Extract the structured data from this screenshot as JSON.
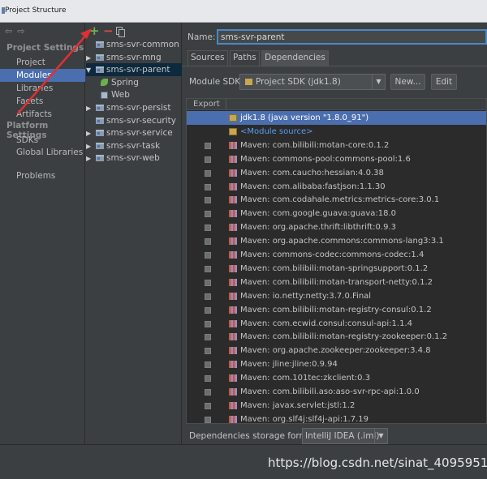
{
  "window": {
    "title": "Project Structure"
  },
  "left_nav": {
    "back_icon": "back-arrow-icon",
    "forward_icon": "forward-arrow-icon",
    "project_settings_header": "Project Settings",
    "project_settings_items": [
      "Project",
      "Modules",
      "Libraries",
      "Facets",
      "Artifacts"
    ],
    "platform_settings_header": "Platform Settings",
    "platform_settings_items": [
      "SDKs",
      "Global Libraries"
    ],
    "problems": "Problems",
    "selected": "Modules"
  },
  "toolbar": {
    "add": "+",
    "remove": "−"
  },
  "module_tree": [
    {
      "label": "sms-svr-common",
      "expandable": false,
      "level": 0
    },
    {
      "label": "sms-svr-mng",
      "expandable": true,
      "level": 0
    },
    {
      "label": "sms-svr-parent",
      "expandable": true,
      "expanded": true,
      "level": 0,
      "selected": true
    },
    {
      "label": "Spring",
      "level": 1,
      "icon": "spring-leaf-icon"
    },
    {
      "label": "Web",
      "level": 1,
      "icon": "web-icon"
    },
    {
      "label": "sms-svr-persist",
      "expandable": true,
      "level": 0
    },
    {
      "label": "sms-svr-security",
      "expandable": false,
      "level": 0
    },
    {
      "label": "sms-svr-service",
      "expandable": true,
      "level": 0
    },
    {
      "label": "sms-svr-task",
      "expandable": true,
      "level": 0
    },
    {
      "label": "sms-svr-web",
      "expandable": true,
      "level": 0
    }
  ],
  "detail": {
    "name_label": "Name:",
    "name_value": "sms-svr-parent",
    "tabs": [
      "Sources",
      "Paths",
      "Dependencies"
    ],
    "active_tab": "Dependencies",
    "module_sdk_label": "Module SDK:",
    "module_sdk_value": "Project SDK (jdk1.8)",
    "new_button": "New...",
    "edit_button": "Edit",
    "export_header": "Export",
    "dependencies": [
      {
        "text": "jdk1.8 (java version \"1.8.0_91\")",
        "kind": "jdk",
        "selected": true,
        "checkbox": false
      },
      {
        "text": "<Module source>",
        "kind": "source",
        "checkbox": false
      },
      {
        "text": "Maven: com.bilibili:motan-core:0.1.2",
        "kind": "maven",
        "checkbox": true
      },
      {
        "text": "Maven: commons-pool:commons-pool:1.6",
        "kind": "maven",
        "checkbox": true
      },
      {
        "text": "Maven: com.caucho:hessian:4.0.38",
        "kind": "maven",
        "checkbox": true
      },
      {
        "text": "Maven: com.alibaba:fastjson:1.1.30",
        "kind": "maven",
        "checkbox": true
      },
      {
        "text": "Maven: com.codahale.metrics:metrics-core:3.0.1",
        "kind": "maven",
        "checkbox": true
      },
      {
        "text": "Maven: com.google.guava:guava:18.0",
        "kind": "maven",
        "checkbox": true
      },
      {
        "text": "Maven: org.apache.thrift:libthrift:0.9.3",
        "kind": "maven",
        "checkbox": true
      },
      {
        "text": "Maven: org.apache.commons:commons-lang3:3.1",
        "kind": "maven",
        "checkbox": true
      },
      {
        "text": "Maven: commons-codec:commons-codec:1.4",
        "kind": "maven",
        "checkbox": true
      },
      {
        "text": "Maven: com.bilibili:motan-springsupport:0.1.2",
        "kind": "maven",
        "checkbox": true
      },
      {
        "text": "Maven: com.bilibili:motan-transport-netty:0.1.2",
        "kind": "maven",
        "checkbox": true
      },
      {
        "text": "Maven: io.netty:netty:3.7.0.Final",
        "kind": "maven",
        "checkbox": true
      },
      {
        "text": "Maven: com.bilibili:motan-registry-consul:0.1.2",
        "kind": "maven",
        "checkbox": true
      },
      {
        "text": "Maven: com.ecwid.consul:consul-api:1.1.4",
        "kind": "maven",
        "checkbox": true
      },
      {
        "text": "Maven: com.bilibili:motan-registry-zookeeper:0.1.2",
        "kind": "maven",
        "checkbox": true
      },
      {
        "text": "Maven: org.apache.zookeeper:zookeeper:3.4.8",
        "kind": "maven",
        "checkbox": true
      },
      {
        "text": "Maven: jline:jline:0.9.94",
        "kind": "maven",
        "checkbox": true
      },
      {
        "text": "Maven: com.101tec:zkclient:0.3",
        "kind": "maven",
        "checkbox": true
      },
      {
        "text": "Maven: com.bilibili.aso:aso-svr-rpc-api:1.0.0",
        "kind": "maven",
        "checkbox": true
      },
      {
        "text": "Maven: javax.servlet:jstl:1.2",
        "kind": "maven",
        "checkbox": true
      },
      {
        "text": "Maven: org.slf4j:slf4j-api:1.7.19",
        "kind": "maven",
        "checkbox": true
      }
    ],
    "storage_format_label": "Dependencies storage format:",
    "storage_format_value": "IntelliJ IDEA (.iml)"
  },
  "watermark": "https://blog.csdn.net/sinat_40959511",
  "colors": {
    "selection": "#4b6eaf",
    "focus_border": "#4a88c7",
    "annotation_arrow": "#e03030"
  }
}
